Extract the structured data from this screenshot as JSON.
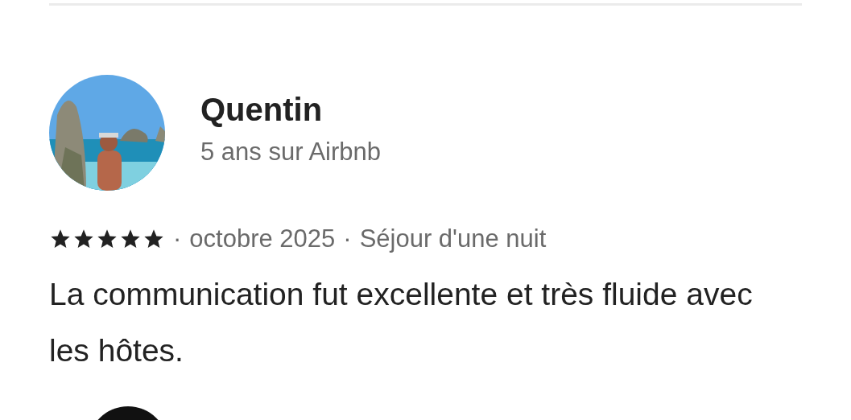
{
  "review": {
    "name": "Quentin",
    "tenure": "5 ans sur Airbnb",
    "stars": 5,
    "separator_1": "·",
    "date": "octobre 2025",
    "separator_2": "·",
    "stay": "Séjour d'une nuit",
    "text": "La communication fut excellente et très fluide avec les hôtes."
  }
}
